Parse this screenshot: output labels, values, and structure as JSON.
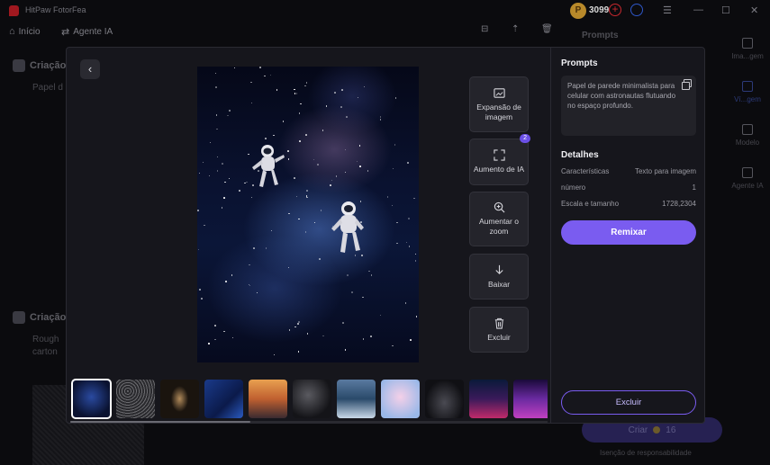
{
  "app": {
    "title": "HitPaw FotorFea",
    "coins": "3099"
  },
  "nav": {
    "home": "Início",
    "agent": "Agente IA"
  },
  "background": {
    "section1_title": "Criação",
    "section1_text": "Papel d",
    "section2_title": "Criação",
    "section2_text1": "Rough",
    "section2_text2": "carton",
    "prompts_label": "Prompts",
    "create_button": "Criar",
    "create_cost": "16",
    "disclaimer": "Isenção de responsabilidade",
    "rail": [
      {
        "label": "Ima...gem",
        "icon": "image-icon"
      },
      {
        "label": "Ví...gem",
        "icon": "video-icon"
      },
      {
        "label": "Modelo",
        "icon": "model-icon"
      },
      {
        "label": "Agente IA",
        "icon": "agent-icon"
      }
    ]
  },
  "modal": {
    "tools": [
      {
        "label": "Expansão de imagem",
        "icon": "expand-image-icon"
      },
      {
        "label": "Aumento de IA",
        "icon": "upscale-icon",
        "badge": "2"
      },
      {
        "label": "Aumentar o zoom",
        "icon": "zoom-in-icon"
      },
      {
        "label": "Baixar",
        "icon": "download-icon"
      },
      {
        "label": "Excluir",
        "icon": "trash-icon"
      }
    ],
    "panel": {
      "prompts_heading": "Prompts",
      "prompt_text": "Papel de parede minimalista para celular com astronautas flutuando no espaço profundo.",
      "details_heading": "Detalhes",
      "details": [
        {
          "key": "Características",
          "value": "Texto para imagem"
        },
        {
          "key": "número",
          "value": "1"
        },
        {
          "key": "Escala e tamanho",
          "value": "1728,2304"
        }
      ],
      "remix_button": "Remixar",
      "delete_button": "Excluir"
    }
  }
}
